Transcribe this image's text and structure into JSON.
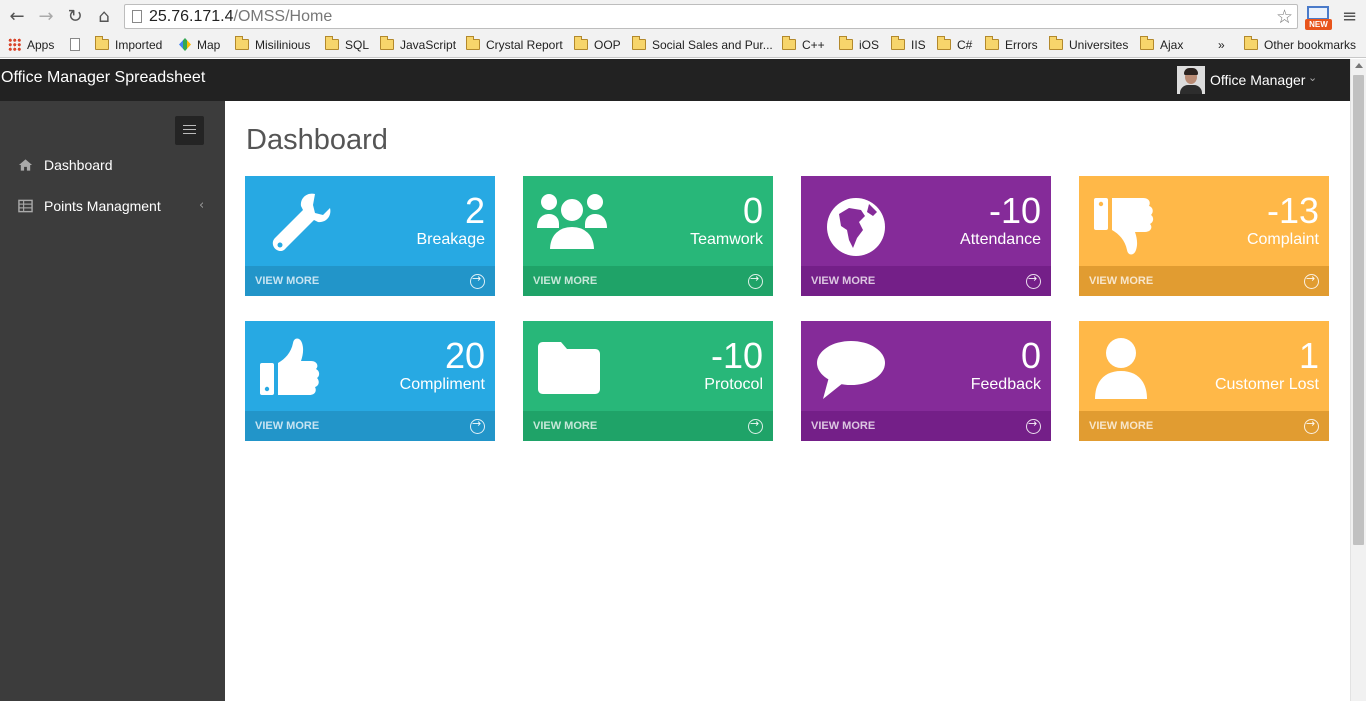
{
  "browser": {
    "url_host": "25.76.171.4",
    "url_path": "/OMSS/Home",
    "ext_badge": "NEW",
    "bookmarks": [
      {
        "label": "Apps",
        "icon": "apps-grid-icon"
      },
      {
        "label": "",
        "icon": "page-icon"
      },
      {
        "label": "Imported",
        "icon": "folder-icon"
      },
      {
        "label": "Map",
        "icon": "map-icon"
      },
      {
        "label": "Misilinious",
        "icon": "folder-icon"
      },
      {
        "label": "SQL",
        "icon": "folder-icon"
      },
      {
        "label": "JavaScript",
        "icon": "folder-icon"
      },
      {
        "label": "Crystal Report",
        "icon": "folder-icon"
      },
      {
        "label": "OOP",
        "icon": "folder-icon"
      },
      {
        "label": "Social Sales and Pur...",
        "icon": "folder-icon"
      },
      {
        "label": "C++",
        "icon": "folder-icon"
      },
      {
        "label": "iOS",
        "icon": "folder-icon"
      },
      {
        "label": "IIS",
        "icon": "folder-icon"
      },
      {
        "label": "C#",
        "icon": "folder-icon"
      },
      {
        "label": "Errors",
        "icon": "folder-icon"
      },
      {
        "label": "Universites",
        "icon": "folder-icon"
      },
      {
        "label": "Ajax",
        "icon": "folder-icon"
      }
    ],
    "overflow": "»",
    "other_bookmarks": "Other bookmarks"
  },
  "app": {
    "title": "Office Manager Spreadsheet",
    "user": "Office Manager"
  },
  "sidebar": {
    "items": [
      {
        "label": "Dashboard",
        "icon": "home-icon"
      },
      {
        "label": "Points Managment",
        "icon": "table-icon"
      }
    ]
  },
  "main": {
    "title": "Dashboard",
    "view_more": "VIEW MORE",
    "tiles": [
      {
        "value": "2",
        "label": "Breakage",
        "icon": "wrench-icon",
        "color": "#27a9e3"
      },
      {
        "value": "0",
        "label": "Teamwork",
        "icon": "group-icon",
        "color": "#28b779"
      },
      {
        "value": "-10",
        "label": "Attendance",
        "icon": "globe-icon",
        "color": "#852b99"
      },
      {
        "value": "-13",
        "label": "Complaint",
        "icon": "thumbs-down-icon",
        "color": "#ffb848"
      },
      {
        "value": "20",
        "label": "Compliment",
        "icon": "thumbs-up-icon",
        "color": "#27a9e3"
      },
      {
        "value": "-10",
        "label": "Protocol",
        "icon": "folder-icon",
        "color": "#28b779"
      },
      {
        "value": "0",
        "label": "Feedback",
        "icon": "comment-icon",
        "color": "#852b99"
      },
      {
        "value": "1",
        "label": "Customer Lost",
        "icon": "user-icon",
        "color": "#ffb848"
      }
    ]
  }
}
